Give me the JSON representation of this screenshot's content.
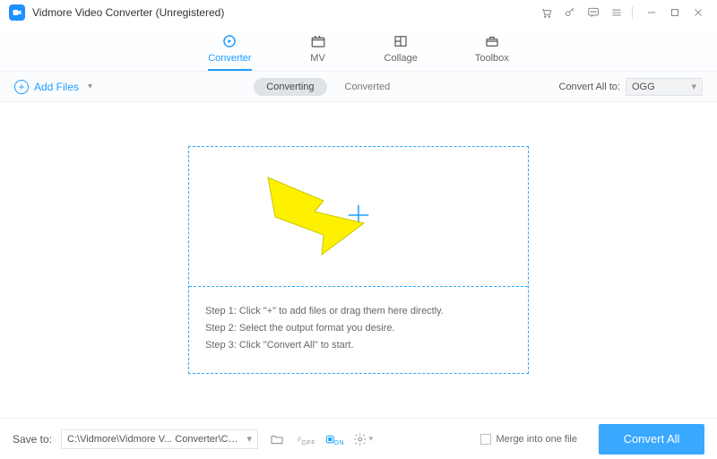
{
  "titlebar": {
    "title": "Vidmore Video Converter (Unregistered)"
  },
  "tabs": {
    "converter": "Converter",
    "mv": "MV",
    "collage": "Collage",
    "toolbox": "Toolbox"
  },
  "subbar": {
    "add_files": "Add Files",
    "converting": "Converting",
    "converted": "Converted",
    "convert_all_to_label": "Convert All to:",
    "format_selected": "OGG"
  },
  "drop": {
    "step1": "Step 1: Click \"+\" to add files or drag them here directly.",
    "step2": "Step 2: Select the output format you desire.",
    "step3": "Step 3: Click \"Convert All\" to start."
  },
  "footer": {
    "save_to_label": "Save to:",
    "path": "C:\\Vidmore\\Vidmore V... Converter\\Converted",
    "hw_off": "OFF",
    "hw_on": "ON",
    "merge_label": "Merge into one file",
    "convert_all": "Convert All"
  }
}
